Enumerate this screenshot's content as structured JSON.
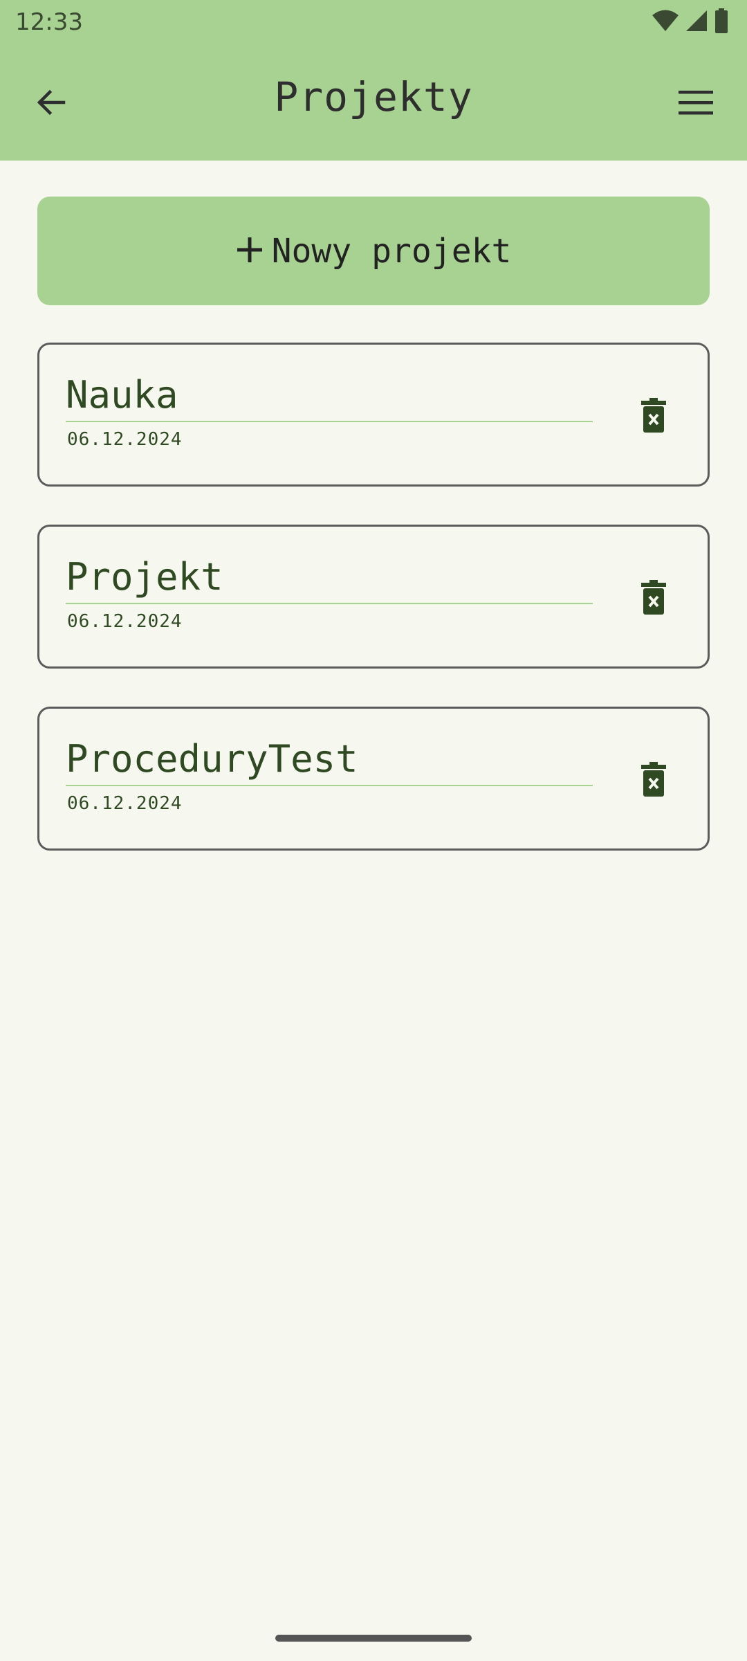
{
  "status_bar": {
    "time": "12:33",
    "icons": [
      "wifi-icon",
      "cell-signal-icon",
      "battery-icon"
    ]
  },
  "app_bar": {
    "title": "Projekty",
    "back_icon": "arrow-back-icon",
    "menu_icon": "hamburger-menu-icon"
  },
  "new_project": {
    "icon": "plus-icon",
    "label": "Nowy projekt"
  },
  "projects": [
    {
      "name": "Nauka",
      "date": "06.12.2024",
      "delete_icon": "trash-x-icon"
    },
    {
      "name": "Projekt",
      "date": "06.12.2024",
      "delete_icon": "trash-x-icon"
    },
    {
      "name": "ProceduryTest",
      "date": "06.12.2024",
      "delete_icon": "trash-x-icon"
    }
  ],
  "colors": {
    "accent": "#a8d292",
    "background": "#f6f7ef",
    "text_dark_green": "#2f4a22",
    "card_border": "#5b5b5b"
  }
}
